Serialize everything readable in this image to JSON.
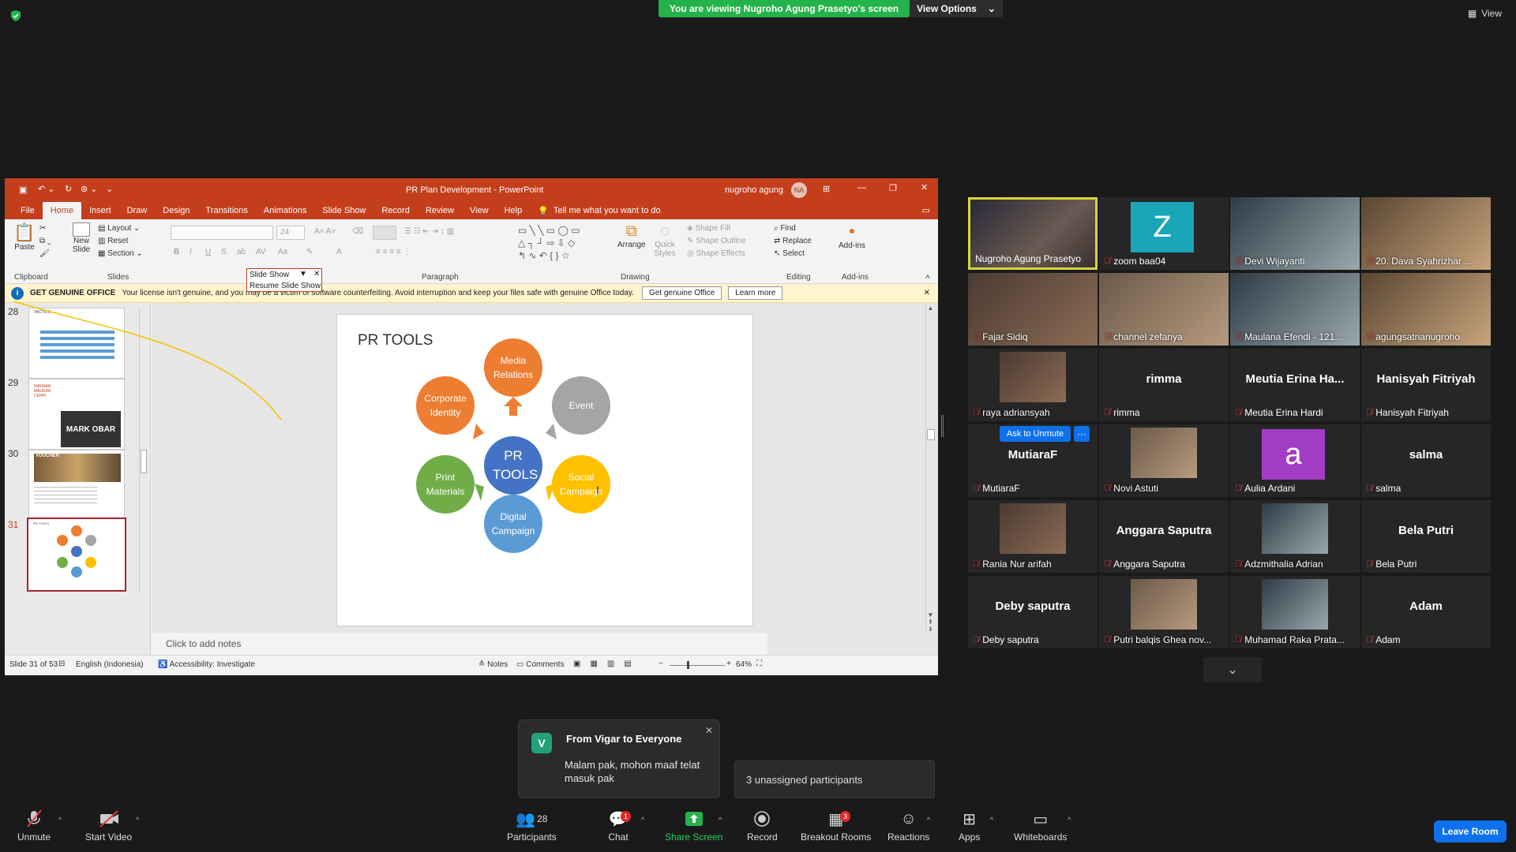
{
  "topbar": {
    "viewing_text": "You are viewing Nugroho Agung Prasetyo's screen",
    "view_options": "View Options",
    "view": "View"
  },
  "ppt": {
    "title": "PR Plan Development  -  PowerPoint",
    "user": "nugroho agung",
    "user_initials": "NA",
    "tabs": [
      "File",
      "Home",
      "Insert",
      "Draw",
      "Design",
      "Transitions",
      "Animations",
      "Slide Show",
      "Record",
      "Review",
      "View",
      "Help"
    ],
    "tell_me": "Tell me what you want to do",
    "ribbon": {
      "paste": "Paste",
      "new_slide": "New Slide",
      "layout": "Layout",
      "reset": "Reset",
      "section": "Section",
      "clipboard": "Clipboard",
      "slides": "Slides",
      "paragraph": "Paragraph",
      "drawing": "Drawing",
      "editing": "Editing",
      "addins_group": "Add-ins",
      "font_size": "24",
      "arrange": "Arrange",
      "quick_styles": "Quick Styles",
      "shape_fill": "Shape Fill",
      "shape_outline": "Shape Outline",
      "shape_effects": "Shape Effects",
      "find": "Find",
      "replace": "Replace",
      "select": "Select",
      "addins": "Add-ins"
    },
    "slideshow_popup": {
      "title": "Slide Show",
      "resume": "Resume Slide Show"
    },
    "genuine": {
      "label": "GET GENUINE OFFICE",
      "message": "Your license isn't genuine, and you may be a victim of software counterfeiting. Avoid interruption and keep your files safe with genuine Office today.",
      "button": "Get genuine Office",
      "learn": "Learn more"
    },
    "thumbnails": [
      {
        "num": "28",
        "title": "TACTICS"
      },
      {
        "num": "29",
        "lines": [
          "NAMAAN",
          "MAUKAH",
          "CEPAT"
        ],
        "brand": "MARK OBAR"
      },
      {
        "num": "30",
        "title": "VOUCHER"
      },
      {
        "num": "31",
        "title": "PR TOOLS",
        "selected": true
      }
    ],
    "slide": {
      "title": "PR TOOLS",
      "center": "PR TOOLS",
      "nodes": [
        {
          "label": "Media Relations",
          "color": "#ed7d31"
        },
        {
          "label": "Event",
          "color": "#a5a5a5"
        },
        {
          "label": "Social Campaign",
          "color": "#ffc000"
        },
        {
          "label": "Digital Campaign",
          "color": "#5b9bd5"
        },
        {
          "label": "Print Materials",
          "color": "#70ad47"
        },
        {
          "label": "Corporate Identity",
          "color": "#ed7d31"
        }
      ],
      "center_color": "#4472c4"
    },
    "notes_placeholder": "Click to add notes",
    "status": {
      "slide": "Slide 31 of 53",
      "language": "English (Indonesia)",
      "accessibility": "Accessibility: Investigate",
      "notes": "Notes",
      "comments": "Comments",
      "zoom": "64%"
    }
  },
  "participants": [
    {
      "name": "Nugroho Agung Prasetyo",
      "video": true,
      "active": true,
      "muted": false
    },
    {
      "name": "zoom baa04",
      "avatar": "Z",
      "avatar_color": "#1aa6b7",
      "muted": true
    },
    {
      "name": "Devi Wijayanti",
      "video": true,
      "muted": true
    },
    {
      "name": "20. Dava Syahrizhar ...",
      "video": true,
      "muted": true
    },
    {
      "name": "Fajar Sidiq",
      "video": true,
      "muted": true
    },
    {
      "name": "channel zefanya",
      "video": true,
      "muted": true
    },
    {
      "name": "Maulana Efendi - 121...",
      "video": true,
      "muted": true
    },
    {
      "name": "agungsatrianugroho",
      "video": true,
      "muted": true
    },
    {
      "name": "raya adriansyah",
      "video": true,
      "muted": true
    },
    {
      "name": "rimma",
      "big": "rimma",
      "muted": true
    },
    {
      "name": "Meutia Erina Hardi",
      "big": "Meutia Erina Ha...",
      "muted": true
    },
    {
      "name": "Hanisyah Fitriyah",
      "big": "Hanisyah Fitriyah",
      "muted": true
    },
    {
      "name": "MutiaraF",
      "big": "MutiaraF",
      "muted": true,
      "ask_unmute": "Ask to Unmute"
    },
    {
      "name": "Novi Astuti",
      "video": true,
      "muted": true
    },
    {
      "name": "Aulia Ardani",
      "avatar": "a",
      "avatar_color": "#a23cc5",
      "muted": true
    },
    {
      "name": "salma",
      "big": "salma",
      "muted": true
    },
    {
      "name": "Rania Nur arifah",
      "video": true,
      "muted": true
    },
    {
      "name": "Anggara Saputra",
      "big": "Anggara Saputra",
      "muted": true
    },
    {
      "name": "Adzmithalia Adrian",
      "video": true,
      "muted": true
    },
    {
      "name": "Bela Putri",
      "big": "Bela Putri",
      "muted": true
    },
    {
      "name": "Deby saputra",
      "big": "Deby saputra",
      "muted": true
    },
    {
      "name": "Putri balqis Ghea nov...",
      "video": true,
      "muted": true
    },
    {
      "name": "Muhamad Raka Prata...",
      "video": true,
      "muted": true
    },
    {
      "name": "Adam",
      "big": "Adam",
      "muted": true
    }
  ],
  "chat_toast": {
    "avatar": "V",
    "from": "From Vigar to Everyone",
    "message": "Malam pak, mohon maaf telat masuk pak"
  },
  "unassigned": "3 unassigned participants",
  "toolbar": {
    "unmute": "Unmute",
    "start_video": "Start Video",
    "participants": "Participants",
    "participants_count": "28",
    "chat": "Chat",
    "chat_badge": "1",
    "share": "Share Screen",
    "record": "Record",
    "breakout": "Breakout Rooms",
    "breakout_badge": "3",
    "reactions": "Reactions",
    "apps": "Apps",
    "whiteboards": "Whiteboards",
    "leave": "Leave Room"
  },
  "colors": {
    "share_green": "#23b34a",
    "ppt_red": "#c43e1c",
    "leave_blue": "#0e71eb"
  }
}
